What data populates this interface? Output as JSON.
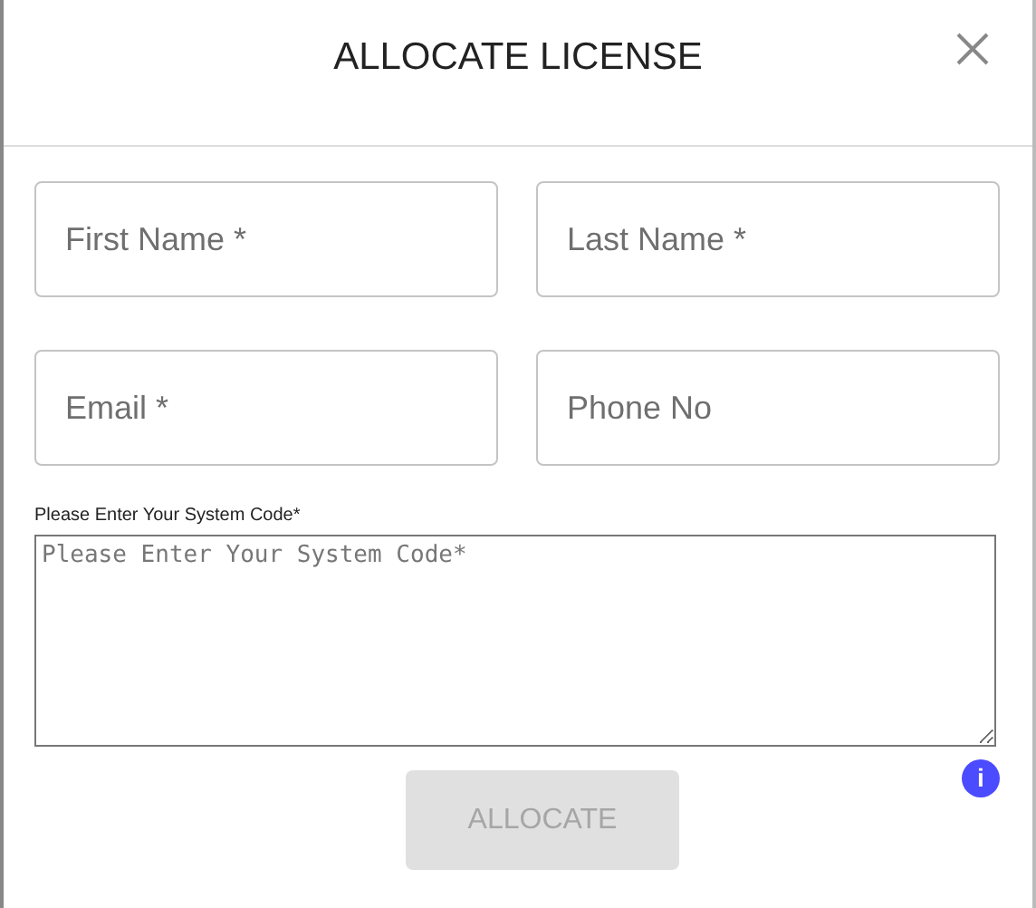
{
  "dialog": {
    "title": "ALLOCATE LICENSE"
  },
  "fields": [
    {
      "placeholder": "First Name *"
    },
    {
      "placeholder": "Last Name *"
    },
    {
      "placeholder": "Email *"
    },
    {
      "placeholder": "Phone No"
    }
  ],
  "system_code": {
    "label": "Please Enter Your System Code*",
    "placeholder": "Please Enter Your System Code*"
  },
  "info_icon": "i",
  "submit": {
    "label": "ALLOCATE",
    "disabled": true
  }
}
